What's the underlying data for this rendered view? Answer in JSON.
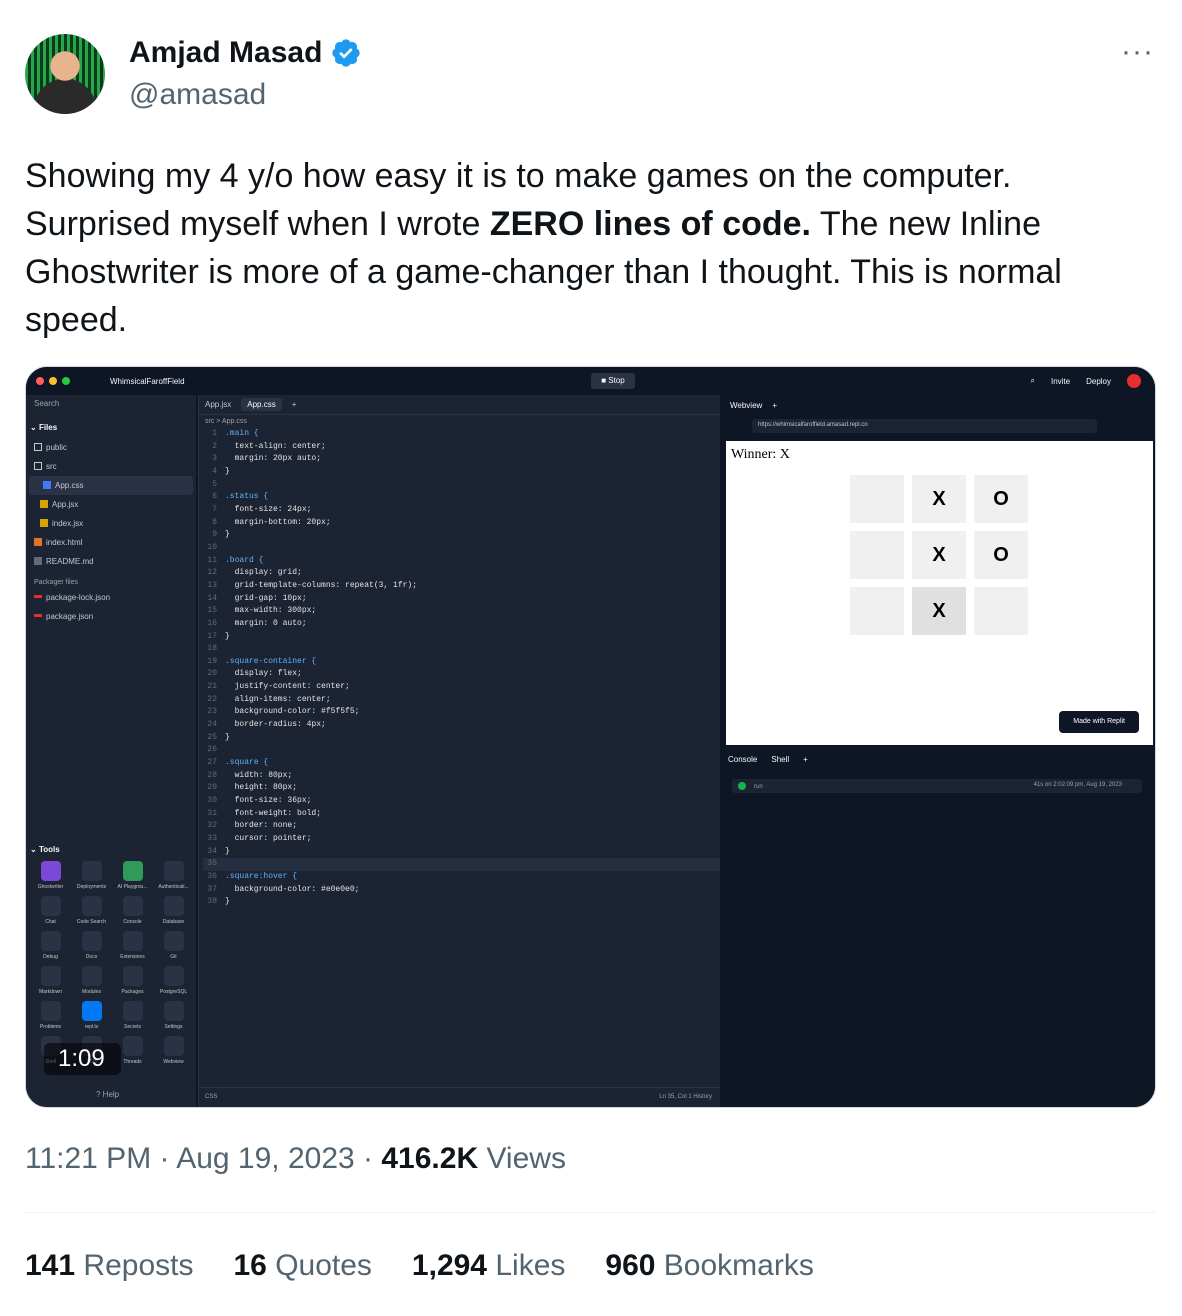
{
  "author": {
    "name": "Amjad Masad",
    "handle": "@amasad"
  },
  "tweet": {
    "text_before": "Showing my 4 y/o how easy it is to make games on the computer. Surprised myself when I wrote ",
    "text_bold": "ZERO lines of code.",
    "text_after": " The new Inline Ghostwriter is more of a game-changer than I thought. This is normal speed.",
    "more_label": "···"
  },
  "video": {
    "duration": "1:09",
    "ide": {
      "repl_name": "WhimsicalFaroffField",
      "stop_label": "Stop",
      "invite_label": "Invite",
      "deploy_label": "Deploy",
      "search_placeholder": "Search",
      "files_header": "Files",
      "files": [
        {
          "name": "public"
        },
        {
          "name": "src"
        },
        {
          "name": "App.css"
        },
        {
          "name": "App.jsx"
        },
        {
          "name": "index.jsx"
        },
        {
          "name": "index.html"
        },
        {
          "name": "README.md"
        }
      ],
      "packager_header": "Packager files",
      "packager_files": [
        {
          "name": "package-lock.json"
        },
        {
          "name": "package.json"
        }
      ],
      "tools_header": "Tools",
      "tools": [
        "Ghostwriter",
        "Deployments",
        "AI Playgrou...",
        "Authenticati...",
        "Chat",
        "Code Search",
        "Console",
        "Database",
        "Debug",
        "Docs",
        "Extensions",
        "Git",
        "Markdown",
        "Modules",
        "Packages",
        "PostgreSQL",
        "Problems",
        "repl.tv",
        "Secrets",
        "Settings",
        "Shell",
        "SSH",
        "Threads",
        "Webview"
      ],
      "help_label": "Help",
      "editor_tabs": [
        "App.jsx",
        "App.css"
      ],
      "breadcrumb": "src  >  App.css",
      "code_lines": [
        ".main {",
        "  text-align: center;",
        "  margin: 20px auto;",
        "}",
        "",
        ".status {",
        "  font-size: 24px;",
        "  margin-bottom: 20px;",
        "}",
        "",
        ".board {",
        "  display: grid;",
        "  grid-template-columns: repeat(3, 1fr);",
        "  grid-gap: 10px;",
        "  max-width: 300px;",
        "  margin: 0 auto;",
        "}",
        "",
        ".square-container {",
        "  display: flex;",
        "  justify-content: center;",
        "  align-items: center;",
        "  background-color: #f5f5f5;",
        "  border-radius: 4px;",
        "}",
        "",
        ".square {",
        "  width: 80px;",
        "  height: 80px;",
        "  font-size: 36px;",
        "  font-weight: bold;",
        "  border: none;",
        "  cursor: pointer;",
        "}",
        "",
        ".square:hover {",
        "  background-color: #e0e0e0;",
        "}"
      ],
      "editor_footer_left": "CSS",
      "editor_footer_right": "Ln 35, Col 1   History",
      "webview_tab": "Webview",
      "url": "https://whimsicalfaroffield.amasad.repl.co",
      "game_status": "Winner: X",
      "board": [
        "",
        "X",
        "O",
        "",
        "X",
        "O",
        "",
        "X",
        ""
      ],
      "made_with": "Made with Replit",
      "console_tab": "Console",
      "shell_tab": "Shell",
      "run_label": "run",
      "run_timestamp": "41s on 2:02:09 pm, Aug 19, 2023"
    }
  },
  "meta": {
    "time": "11:21 PM",
    "date": "Aug 19, 2023",
    "views_count": "416.2K",
    "views_label": "Views"
  },
  "stats": {
    "reposts_count": "141",
    "reposts_label": "Reposts",
    "quotes_count": "16",
    "quotes_label": "Quotes",
    "likes_count": "1,294",
    "likes_label": "Likes",
    "bookmarks_count": "960",
    "bookmarks_label": "Bookmarks"
  },
  "colors": {
    "verified": "#1d9bf0",
    "text_primary": "#0f1419",
    "text_secondary": "#536471",
    "ide_bg": "#0e1525"
  }
}
